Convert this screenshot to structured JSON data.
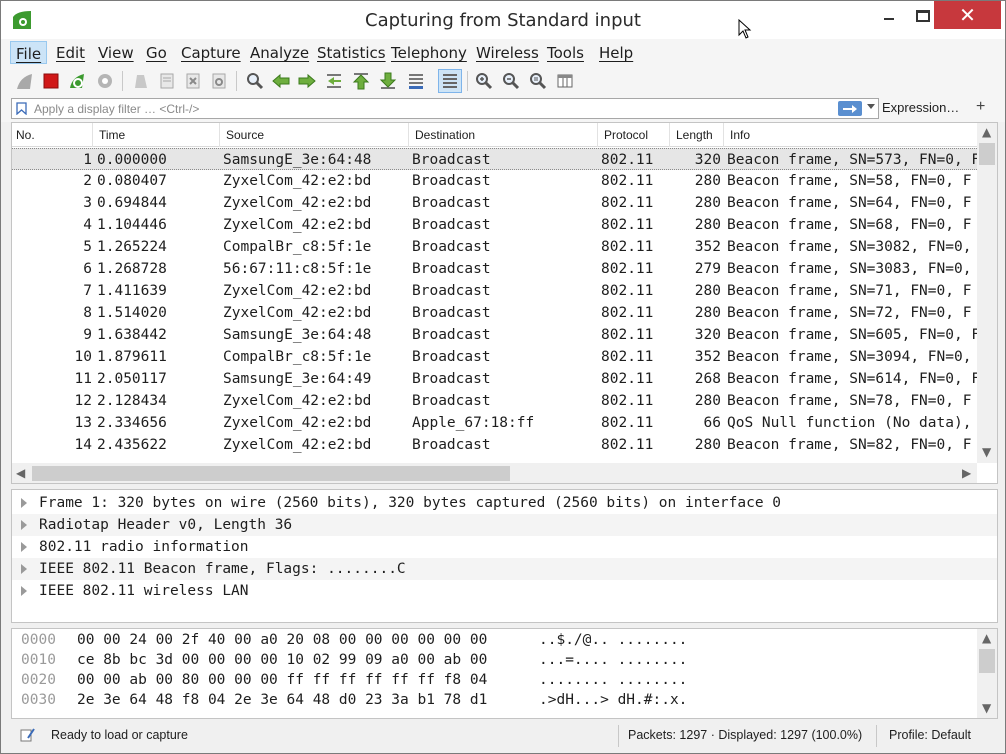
{
  "window": {
    "title": "Capturing from Standard input",
    "close_glyph": "✕"
  },
  "menu": [
    {
      "label": "File",
      "active": true
    },
    {
      "label": "Edit"
    },
    {
      "label": "View"
    },
    {
      "label": "Go"
    },
    {
      "label": "Capture"
    },
    {
      "label": "Analyze"
    },
    {
      "label": "Statistics"
    },
    {
      "label": "Telephony"
    },
    {
      "label": "Wireless"
    },
    {
      "label": "Tools"
    },
    {
      "label": "Help"
    }
  ],
  "toolbar": {
    "icons": [
      "shark-fin-icon",
      "stop-capture-icon",
      "restart-capture-icon",
      "capture-options-icon",
      "open-file-icon",
      "save-file-icon",
      "close-file-icon",
      "reload-file-icon",
      "find-packet-icon",
      "go-back-icon",
      "go-forward-icon",
      "go-to-packet-icon",
      "go-first-icon",
      "go-last-icon",
      "autoscroll-icon",
      "colorize-icon",
      "zoom-in-icon",
      "zoom-out-icon",
      "zoom-normal-icon",
      "resize-columns-icon"
    ]
  },
  "filter": {
    "placeholder": "Apply a display filter … <Ctrl-/>",
    "expression_label": "Expression…",
    "add_label": "+"
  },
  "packet_list": {
    "columns": [
      "No.",
      "Time",
      "Source",
      "Destination",
      "Protocol",
      "Length",
      "Info"
    ],
    "rows": [
      {
        "no": "1",
        "time": "0.000000",
        "source": "SamsungE_3e:64:48",
        "destination": "Broadcast",
        "protocol": "802.11",
        "length": "320",
        "info": "Beacon frame, SN=573, FN=0, F"
      },
      {
        "no": "2",
        "time": "0.080407",
        "source": "ZyxelCom_42:e2:bd",
        "destination": "Broadcast",
        "protocol": "802.11",
        "length": "280",
        "info": "Beacon frame, SN=58, FN=0, F"
      },
      {
        "no": "3",
        "time": "0.694844",
        "source": "ZyxelCom_42:e2:bd",
        "destination": "Broadcast",
        "protocol": "802.11",
        "length": "280",
        "info": "Beacon frame, SN=64, FN=0, F"
      },
      {
        "no": "4",
        "time": "1.104446",
        "source": "ZyxelCom_42:e2:bd",
        "destination": "Broadcast",
        "protocol": "802.11",
        "length": "280",
        "info": "Beacon frame, SN=68, FN=0, F"
      },
      {
        "no": "5",
        "time": "1.265224",
        "source": "CompalBr_c8:5f:1e",
        "destination": "Broadcast",
        "protocol": "802.11",
        "length": "352",
        "info": "Beacon frame, SN=3082, FN=0,"
      },
      {
        "no": "6",
        "time": "1.268728",
        "source": "56:67:11:c8:5f:1e",
        "destination": "Broadcast",
        "protocol": "802.11",
        "length": "279",
        "info": "Beacon frame, SN=3083, FN=0,"
      },
      {
        "no": "7",
        "time": "1.411639",
        "source": "ZyxelCom_42:e2:bd",
        "destination": "Broadcast",
        "protocol": "802.11",
        "length": "280",
        "info": "Beacon frame, SN=71, FN=0, F"
      },
      {
        "no": "8",
        "time": "1.514020",
        "source": "ZyxelCom_42:e2:bd",
        "destination": "Broadcast",
        "protocol": "802.11",
        "length": "280",
        "info": "Beacon frame, SN=72, FN=0, F"
      },
      {
        "no": "9",
        "time": "1.638442",
        "source": "SamsungE_3e:64:48",
        "destination": "Broadcast",
        "protocol": "802.11",
        "length": "320",
        "info": "Beacon frame, SN=605, FN=0, F"
      },
      {
        "no": "10",
        "time": "1.879611",
        "source": "CompalBr_c8:5f:1e",
        "destination": "Broadcast",
        "protocol": "802.11",
        "length": "352",
        "info": "Beacon frame, SN=3094, FN=0,"
      },
      {
        "no": "11",
        "time": "2.050117",
        "source": "SamsungE_3e:64:49",
        "destination": "Broadcast",
        "protocol": "802.11",
        "length": "268",
        "info": "Beacon frame, SN=614, FN=0, F"
      },
      {
        "no": "12",
        "time": "2.128434",
        "source": "ZyxelCom_42:e2:bd",
        "destination": "Broadcast",
        "protocol": "802.11",
        "length": "280",
        "info": "Beacon frame, SN=78, FN=0, F"
      },
      {
        "no": "13",
        "time": "2.334656",
        "source": "ZyxelCom_42:e2:bd",
        "destination": "Apple_67:18:ff",
        "protocol": "802.11",
        "length": "66",
        "info": "QoS Null function (No data),"
      },
      {
        "no": "14",
        "time": "2.435622",
        "source": "ZyxelCom_42:e2:bd",
        "destination": "Broadcast",
        "protocol": "802.11",
        "length": "280",
        "info": "Beacon frame, SN=82, FN=0, F"
      }
    ],
    "selected_index": 0
  },
  "details": [
    "Frame 1: 320 bytes on wire (2560 bits), 320 bytes captured (2560 bits) on interface 0",
    "Radiotap Header v0, Length 36",
    "802.11 radio information",
    "IEEE 802.11 Beacon frame, Flags: ........C",
    "IEEE 802.11 wireless LAN"
  ],
  "bytes": [
    {
      "offset": "0000",
      "hex": "00 00 24 00 2f 40 00 a0  20 08 00 00 00 00 00 00",
      "ascii": "..$./@..  ........"
    },
    {
      "offset": "0010",
      "hex": "ce 8b bc 3d 00 00 00 00  10 02 99 09 a0 00 ab 00",
      "ascii": "...=....  ........"
    },
    {
      "offset": "0020",
      "hex": "00 00 ab 00 80 00 00 00  ff ff ff ff ff ff f8 04",
      "ascii": "........  ........"
    },
    {
      "offset": "0030",
      "hex": "2e 3e 64 48 f8 04 2e 3e  64 48 d0 23 3a b1 78 d1",
      "ascii": ".>dH...>  dH.#:.x."
    }
  ],
  "status": {
    "ready_text": "Ready to load or capture",
    "packets_text": "Packets: 1297 · Displayed: 1297 (100.0%)",
    "profile_text": "Profile: Default"
  },
  "colors": {
    "close_button": "#c7383d",
    "menu_active": "#cce4f7",
    "selected_row": "#e6e6e6",
    "logo_green": "#3c9a2f",
    "stop_red": "#d01818"
  }
}
